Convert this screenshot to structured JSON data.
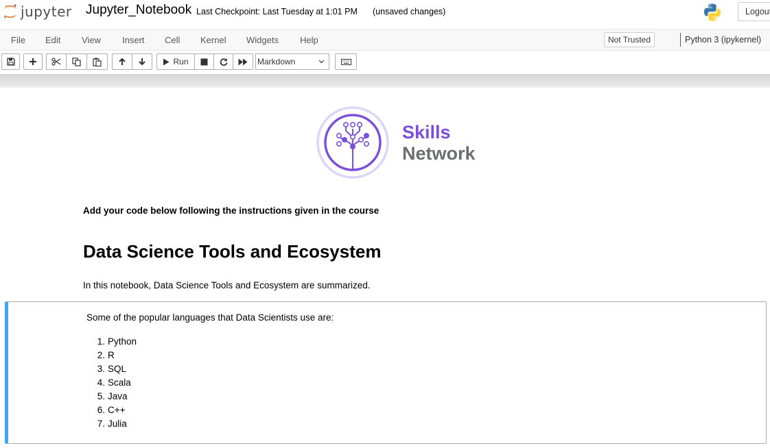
{
  "header": {
    "brand": "jupyter",
    "notebook_name": "Jupyter_Notebook",
    "checkpoint": "Last Checkpoint: Last Tuesday at 1:01 PM",
    "unsaved": "(unsaved changes)",
    "logout": "Logout"
  },
  "menubar": {
    "items": [
      "File",
      "Edit",
      "View",
      "Insert",
      "Cell",
      "Kernel",
      "Widgets",
      "Help"
    ],
    "trust_status": "Not Trusted",
    "kernel": "Python 3 (ipykernel)"
  },
  "toolbar": {
    "run_label": "Run",
    "cell_type": "Markdown",
    "buttons": [
      "save-icon",
      "plus-icon",
      "scissors-icon",
      "copy-icon",
      "paste-icon",
      "arrow-up-icon",
      "arrow-down-icon",
      "play-icon",
      "stop-icon",
      "restart-icon",
      "fast-forward-icon",
      "keyboard-icon"
    ]
  },
  "notebook": {
    "logo": {
      "line1": "Skills",
      "line2": "Network"
    },
    "instruction": "Add your code below following the instructions given in the course",
    "heading": "Data Science Tools and Ecosystem",
    "intro": "In this notebook, Data Science Tools and Ecosystem are summarized.",
    "languages_lead": "Some of the popular languages that Data Scientists use are:",
    "languages": [
      "Python",
      "R",
      "SQL",
      "Scala",
      "Java",
      "C++",
      "Julia"
    ]
  },
  "colors": {
    "accent": "#42a5f5",
    "skills_purple": "#7b4fd9",
    "jupyter_orange": "#f37726",
    "network_gray": "#6d6e70"
  }
}
